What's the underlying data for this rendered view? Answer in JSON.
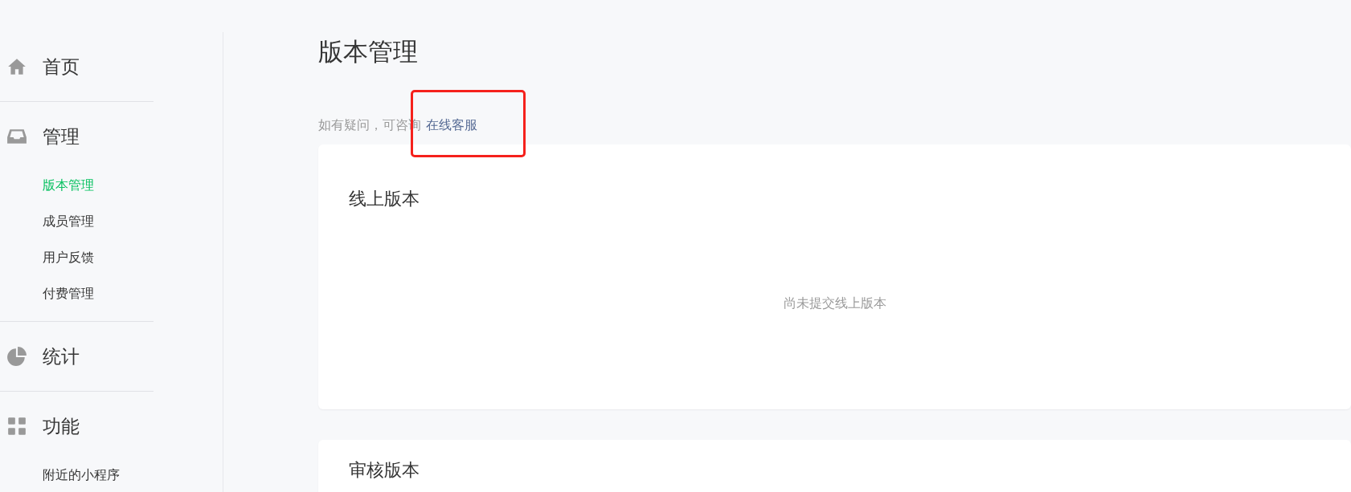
{
  "sidebar": {
    "sections": [
      {
        "title": "首页"
      },
      {
        "title": "管理",
        "items": [
          {
            "label": "版本管理",
            "selected": true
          },
          {
            "label": "成员管理",
            "selected": false
          },
          {
            "label": "用户反馈",
            "selected": false
          },
          {
            "label": "付费管理",
            "selected": false
          }
        ]
      },
      {
        "title": "统计"
      },
      {
        "title": "功能",
        "items": [
          {
            "label": "附近的小程序",
            "selected": false
          }
        ]
      }
    ]
  },
  "page": {
    "title": "版本管理",
    "help_text": "如有疑问，可咨询",
    "help_link": "在线客服",
    "cards": [
      {
        "title": "线上版本",
        "empty_text": "尚未提交线上版本"
      },
      {
        "title": "审核版本"
      }
    ]
  }
}
